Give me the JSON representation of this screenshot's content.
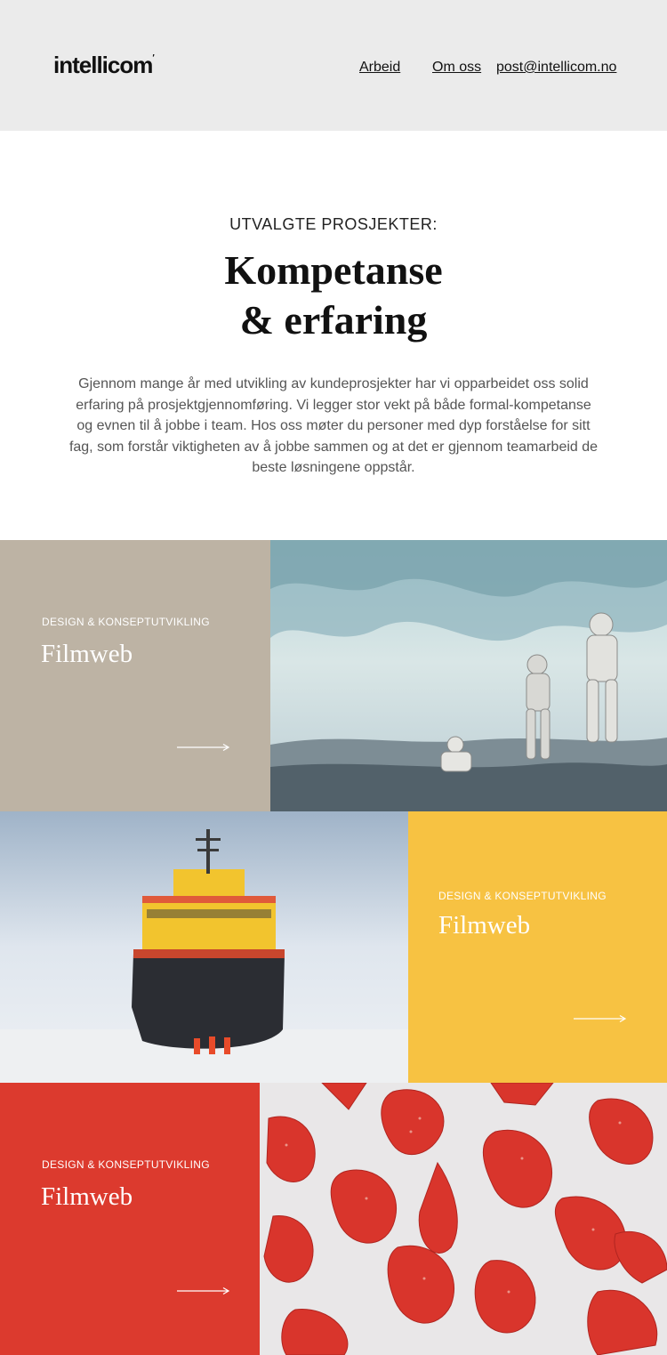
{
  "header": {
    "logo": "intellicom",
    "nav": [
      {
        "label": "Arbeid"
      },
      {
        "label": "Om oss"
      },
      {
        "label": "post@intellicom.no"
      }
    ]
  },
  "intro": {
    "eyebrow": "UTVALGTE PROSJEKTER:",
    "title_line1": "Kompetanse",
    "title_line2": "& erfaring",
    "body": "Gjennom mange år med utvikling av kundeprosjekter har vi opparbeidet oss solid erfaring på prosjektgjennomføring. Vi legger stor vekt på både formal-kompetanse og evnen til å jobbe i team. Hos oss møter du personer med dyp forståelse for sitt fag, som forstår viktigheten av å jobbe sammen og at det er gjennom teamarbeid de beste løsningene oppstår."
  },
  "projects": [
    {
      "category": "DESIGN & KONSEPTUTVIKLING",
      "title": "Filmweb",
      "image": "astronauts-on-ice-planet",
      "color": "#bdb3a4"
    },
    {
      "category": "DESIGN & KONSEPTUTVIKLING",
      "title": "Filmweb",
      "image": "icebreaker-ship",
      "color": "#f7c242"
    },
    {
      "category": "DESIGN & KONSEPTUTVIKLING",
      "title": "Filmweb",
      "image": "strawberries",
      "color": "#dc3a2e"
    }
  ],
  "icons": {
    "arrow": "arrow-right-icon"
  }
}
